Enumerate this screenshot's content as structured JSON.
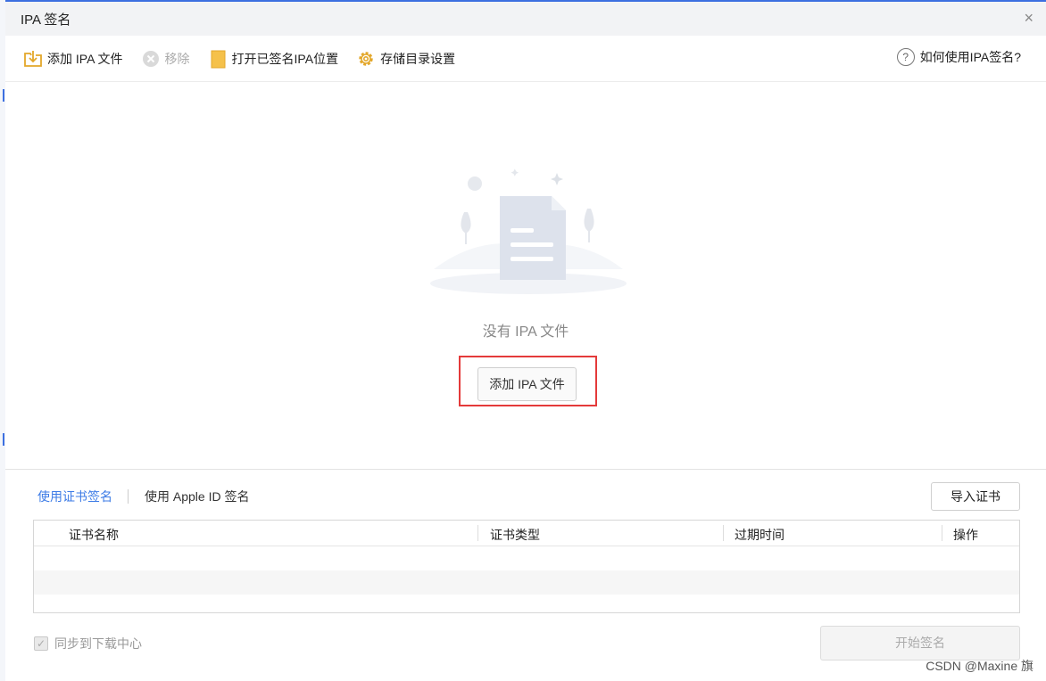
{
  "window": {
    "title": "IPA 签名",
    "close_glyph": "×"
  },
  "toolbar": {
    "add_label": "添加 IPA 文件",
    "remove_label": "移除",
    "open_location_label": "打开已签名IPA位置",
    "storage_settings_label": "存储目录设置",
    "help_label": "如何使用IPA签名?"
  },
  "empty_state": {
    "message": "没有 IPA 文件",
    "add_button_label": "添加 IPA 文件"
  },
  "sign_tabs": [
    {
      "label": "使用证书签名",
      "active": true
    },
    {
      "label": "使用 Apple ID 签名",
      "active": false
    }
  ],
  "import_cert_label": "导入证书",
  "cert_table": {
    "columns": [
      "证书名称",
      "证书类型",
      "过期时间",
      "操作"
    ],
    "rows": []
  },
  "sync_checkbox": {
    "label": "同步到下载中心",
    "checked": true
  },
  "start_button_label": "开始签名",
  "watermark": "CSDN @Maxine 旗",
  "colors": {
    "accent": "#3c7be6",
    "highlight": "#e43a3a",
    "icon_yellow": "#f5c14a"
  }
}
